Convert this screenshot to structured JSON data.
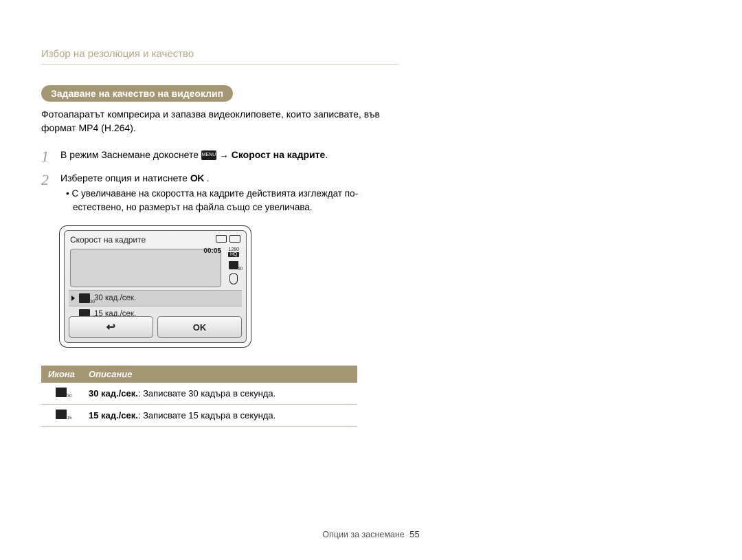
{
  "breadcrumb": "Избор на резолюция и качество",
  "section_title": "Задаване на качество на видеоклип",
  "intro": "Фотоапаратът компресира и запазва видеоклиповете, които записвате, във формат MP4 (H.264).",
  "steps": {
    "s1_pre": "В режим Заснемане докоснете ",
    "s1_menu": "MENU",
    "s1_arrow": " → ",
    "s1_bold": "Скорост на кадрите",
    "s1_post": ".",
    "s2_pre": "Изберете опция и натиснете ",
    "s2_ok": "OK",
    "s2_post": " .",
    "bullet": "С увеличаване на скоростта на кадрите действията изглеждат по-естествено, но размерът на файла също се увеличава."
  },
  "lcd": {
    "title": "Скорост на кадрите",
    "timer": "00:05",
    "res_top": "1280",
    "res_bot": "HQ",
    "opt30": "30 кад./сек.",
    "opt15": "15 кад./сек.",
    "ok": "OK"
  },
  "table": {
    "h_icon": "Икона",
    "h_desc": "Описание",
    "r30_bold": "30 кад./сек.",
    "r30_text": ": Записвате 30 кадъра в секунда.",
    "r15_bold": "15 кад./сек.",
    "r15_text": ": Записвате 15 кадъра в секунда."
  },
  "footer": {
    "label": "Опции за заснемане",
    "page": "55"
  }
}
